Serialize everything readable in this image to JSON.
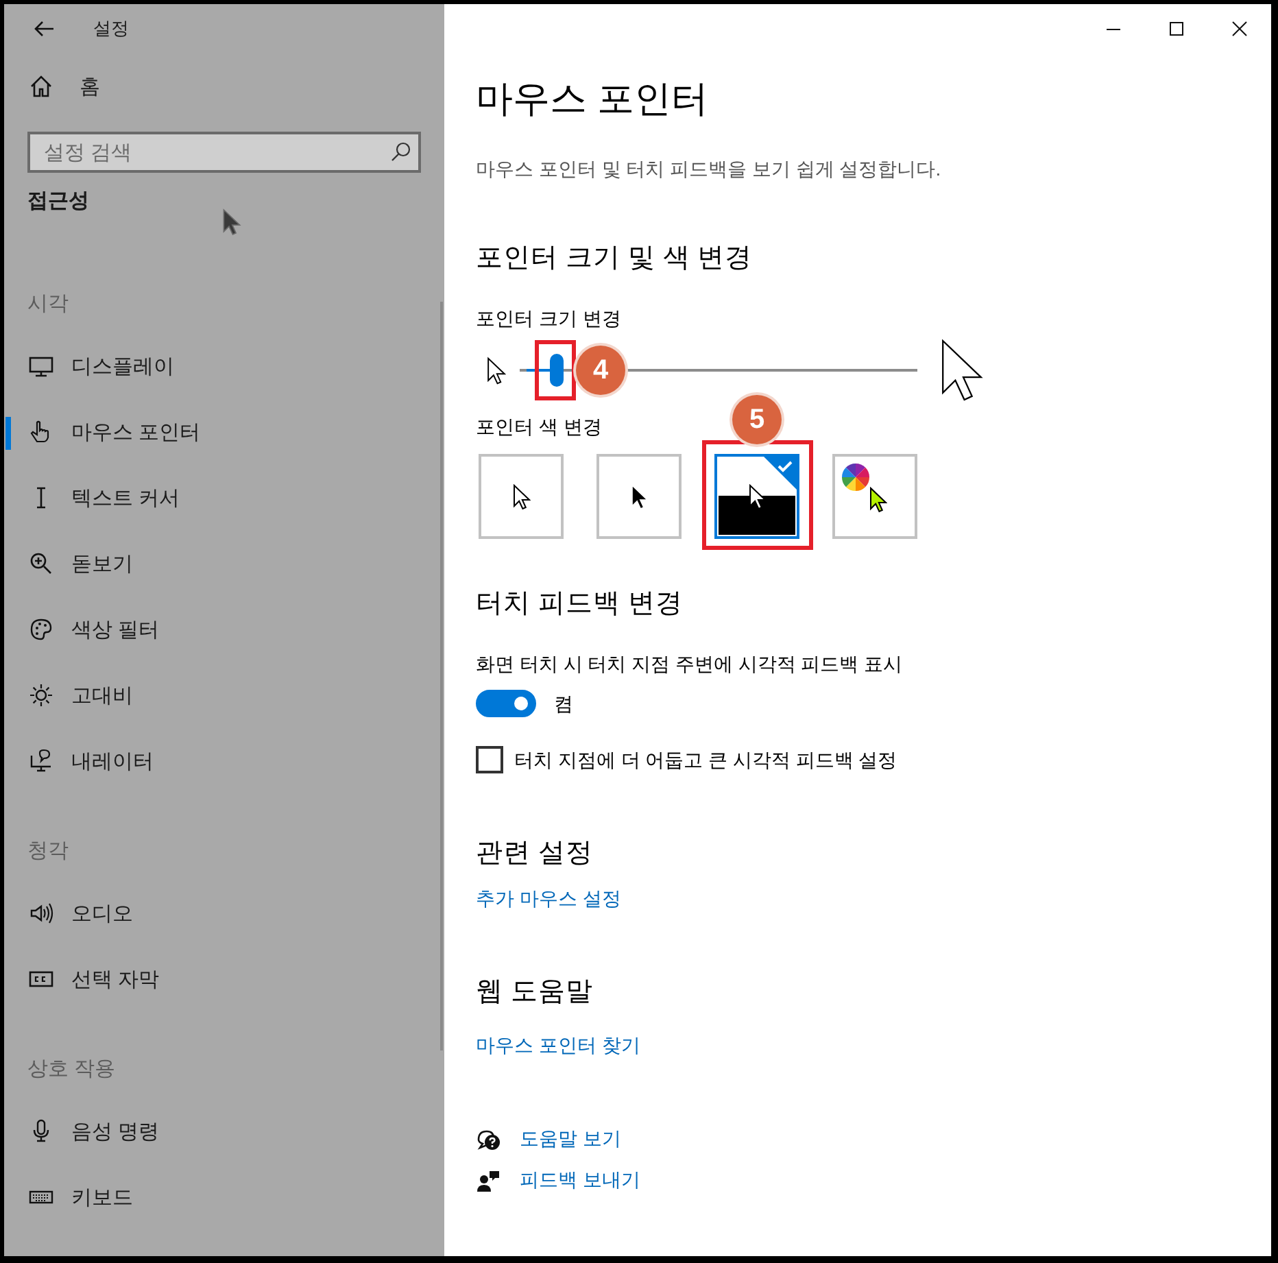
{
  "window": {
    "title": "설정"
  },
  "sidebar": {
    "home": "홈",
    "search": {
      "placeholder": "설정 검색"
    },
    "section": "접근성",
    "groups": [
      {
        "header": "시각",
        "items": [
          {
            "label": "디스플레이",
            "selected": false
          },
          {
            "label": "마우스 포인터",
            "selected": true
          },
          {
            "label": "텍스트 커서",
            "selected": false
          },
          {
            "label": "돋보기",
            "selected": false
          },
          {
            "label": "색상 필터",
            "selected": false
          },
          {
            "label": "고대비",
            "selected": false
          },
          {
            "label": "내레이터",
            "selected": false
          }
        ]
      },
      {
        "header": "청각",
        "items": [
          {
            "label": "오디오",
            "selected": false
          },
          {
            "label": "선택 자막",
            "selected": false
          }
        ]
      },
      {
        "header": "상호 작용",
        "items": [
          {
            "label": "음성 명령",
            "selected": false
          },
          {
            "label": "키보드",
            "selected": false
          }
        ]
      }
    ]
  },
  "page": {
    "title": "마우스 포인터",
    "description": "마우스 포인터 및 터치 피드백을 보기 쉽게 설정합니다."
  },
  "pointer_section": {
    "heading": "포인터 크기 및 색 변경",
    "size_label": "포인터 크기 변경",
    "size_slider": {
      "level": 0.08
    },
    "color_label": "포인터 색 변경",
    "color_options": [
      {
        "kind": "white",
        "selected": false
      },
      {
        "kind": "black",
        "selected": false
      },
      {
        "kind": "inverted",
        "selected": true
      },
      {
        "kind": "custom",
        "selected": false
      }
    ]
  },
  "annotations": [
    {
      "label": "4"
    },
    {
      "label": "5"
    }
  ],
  "touch_section": {
    "heading": "터치 피드백 변경",
    "toggle_label": "화면 터치 시 터치 지점 주변에 시각적 피드백 표시",
    "toggle": {
      "on": true,
      "state_text": "켬"
    },
    "checkbox": {
      "label": "터치 지점에 더 어둡고 큰 시각적 피드백 설정",
      "checked": false
    }
  },
  "related": {
    "heading": "관련 설정",
    "links": [
      "추가 마우스 설정"
    ]
  },
  "web_help": {
    "heading": "웹 도움말",
    "links": [
      "마우스 포인터 찾기"
    ]
  },
  "help_links": [
    "도움말 보기",
    "피드백 보내기"
  ]
}
